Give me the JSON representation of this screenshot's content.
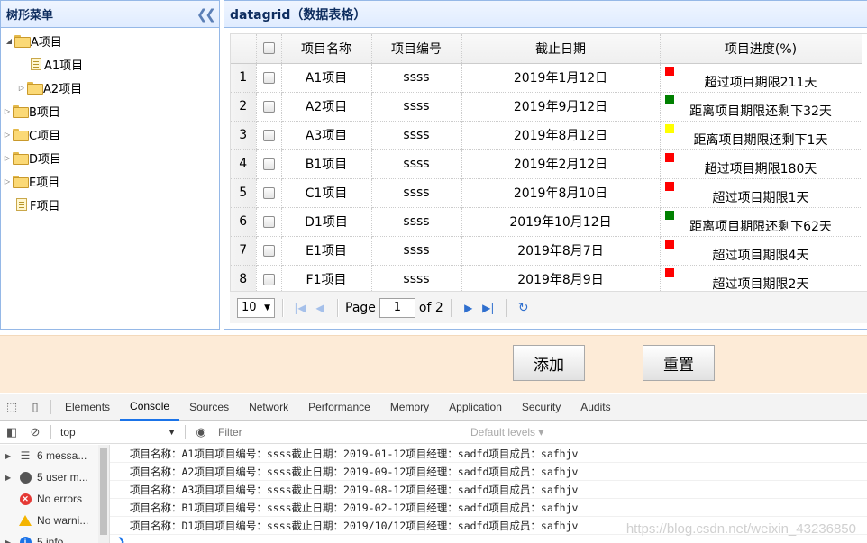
{
  "tree_panel": {
    "title": "树形菜单",
    "collapse_icon": "double-chevron-left-icon",
    "nodes": [
      {
        "label": "A项目",
        "state": "expanded"
      },
      {
        "label": "A1项目",
        "state": "leaf"
      },
      {
        "label": "A2项目",
        "state": "collapsed"
      },
      {
        "label": "B项目",
        "state": "collapsed"
      },
      {
        "label": "C项目",
        "state": "collapsed"
      },
      {
        "label": "D项目",
        "state": "collapsed"
      },
      {
        "label": "E项目",
        "state": "collapsed"
      },
      {
        "label": "F项目",
        "state": "leaf"
      }
    ]
  },
  "grid_panel": {
    "title": "datagrid（数据表格）",
    "columns": [
      "项目名称",
      "项目编号",
      "截止日期",
      "项目进度(%)"
    ],
    "rows": [
      {
        "num": "1",
        "name": "A1项目",
        "code": "ssss",
        "date": "2019年1月12日",
        "progress": "超过项目期限211天",
        "status_color": "#ff0000"
      },
      {
        "num": "2",
        "name": "A2项目",
        "code": "ssss",
        "date": "2019年9月12日",
        "progress": "距离项目期限还剩下32天",
        "status_color": "#008000"
      },
      {
        "num": "3",
        "name": "A3项目",
        "code": "ssss",
        "date": "2019年8月12日",
        "progress": "距离项目期限还剩下1天",
        "status_color": "#ffff00"
      },
      {
        "num": "4",
        "name": "B1项目",
        "code": "ssss",
        "date": "2019年2月12日",
        "progress": "超过项目期限180天",
        "status_color": "#ff0000"
      },
      {
        "num": "5",
        "name": "C1项目",
        "code": "ssss",
        "date": "2019年8月10日",
        "progress": "超过项目期限1天",
        "status_color": "#ff0000"
      },
      {
        "num": "6",
        "name": "D1项目",
        "code": "ssss",
        "date": "2019年10月12日",
        "progress": "距离项目期限还剩下62天",
        "status_color": "#008000"
      },
      {
        "num": "7",
        "name": "E1项目",
        "code": "ssss",
        "date": "2019年8月7日",
        "progress": "超过项目期限4天",
        "status_color": "#ff0000"
      },
      {
        "num": "8",
        "name": "F1项目",
        "code": "ssss",
        "date": "2019年8月9日",
        "progress": "超过项目期限2天",
        "status_color": "#ff0000"
      }
    ],
    "pager": {
      "page_size": "10",
      "page_label": "Page",
      "current_page": "1",
      "of_label": "of 2"
    }
  },
  "actions": {
    "add_label": "添加",
    "reset_label": "重置"
  },
  "devtools": {
    "tabs": [
      "Elements",
      "Console",
      "Sources",
      "Network",
      "Performance",
      "Memory",
      "Application",
      "Security",
      "Audits"
    ],
    "active_tab": "Console",
    "context": "top",
    "filter_placeholder": "Filter",
    "levels_label": "Default levels ▾",
    "sidebar": [
      {
        "label": "6 messa...",
        "icon": "list-icon"
      },
      {
        "label": "5 user m...",
        "icon": "user-icon"
      },
      {
        "label": "No errors",
        "icon": "error-icon"
      },
      {
        "label": "No warni...",
        "icon": "warning-icon"
      },
      {
        "label": "5 info",
        "icon": "info-icon"
      }
    ],
    "logs": [
      "项目名称：A1项目项目编号：ssss截止日期：2019-01-12项目经理：sadfd项目成员：safhjv",
      "项目名称：A2项目项目编号：ssss截止日期：2019-09-12项目经理：sadfd项目成员：safhjv",
      "项目名称：A3项目项目编号：ssss截止日期：2019-08-12项目经理：sadfd项目成员：safhjv",
      "项目名称：B1项目项目编号：ssss截止日期：2019-02-12项目经理：sadfd项目成员：safhjv",
      "项目名称：D1项目项目编号：ssss截止日期：2019/10/12项目经理：sadfd项目成员：safhjv"
    ],
    "watermark": "https://blog.csdn.net/weixin_43236850"
  }
}
